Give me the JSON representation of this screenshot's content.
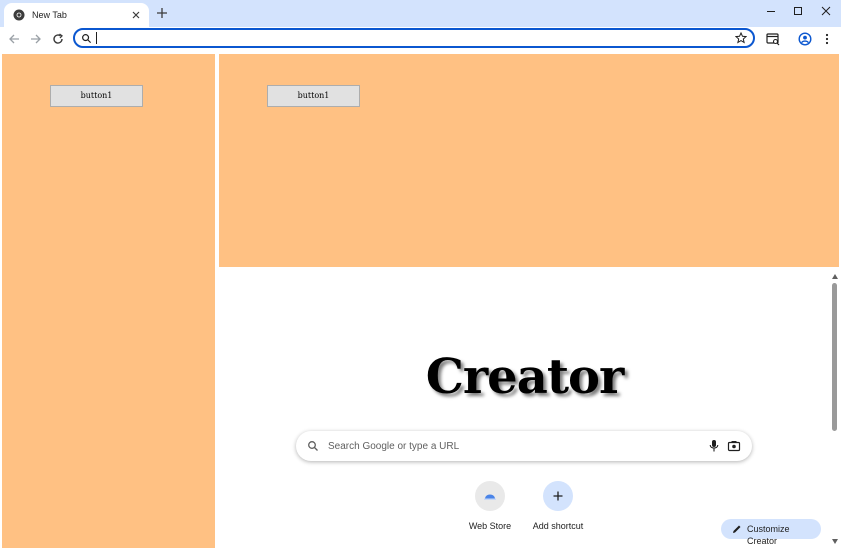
{
  "browser": {
    "tab_title": "New Tab",
    "omnibox_value": "",
    "icons": {
      "tab_favicon": "chrome-icon",
      "tab_close": "close-icon",
      "new_tab": "plus-icon",
      "back": "back-arrow-icon",
      "forward": "forward-arrow-icon",
      "reload": "reload-icon",
      "omnibox_search": "search-icon",
      "bookmark": "star-icon",
      "tab_search": "tab-search-icon",
      "profile": "profile-icon",
      "menu": "kebab-menu-icon",
      "minimize": "minimize-icon",
      "maximize": "maximize-icon",
      "close": "close-window-icon"
    }
  },
  "left_panel": {
    "button_label": "button1",
    "color": "#ffc183"
  },
  "top_panel": {
    "button_label": "button1",
    "color": "#ffc183"
  },
  "ntp": {
    "logo_text": "Creator",
    "search_placeholder": "Search Google or type a URL",
    "shortcuts": [
      {
        "label": "Web Store",
        "icon": "web-store-icon"
      },
      {
        "label": "Add shortcut",
        "icon": "plus-icon"
      }
    ],
    "customize_label": "Customize Creator"
  },
  "colors": {
    "accent": "#0b57d0",
    "tabstrip": "#d3e3fd",
    "panel": "#ffc183"
  }
}
